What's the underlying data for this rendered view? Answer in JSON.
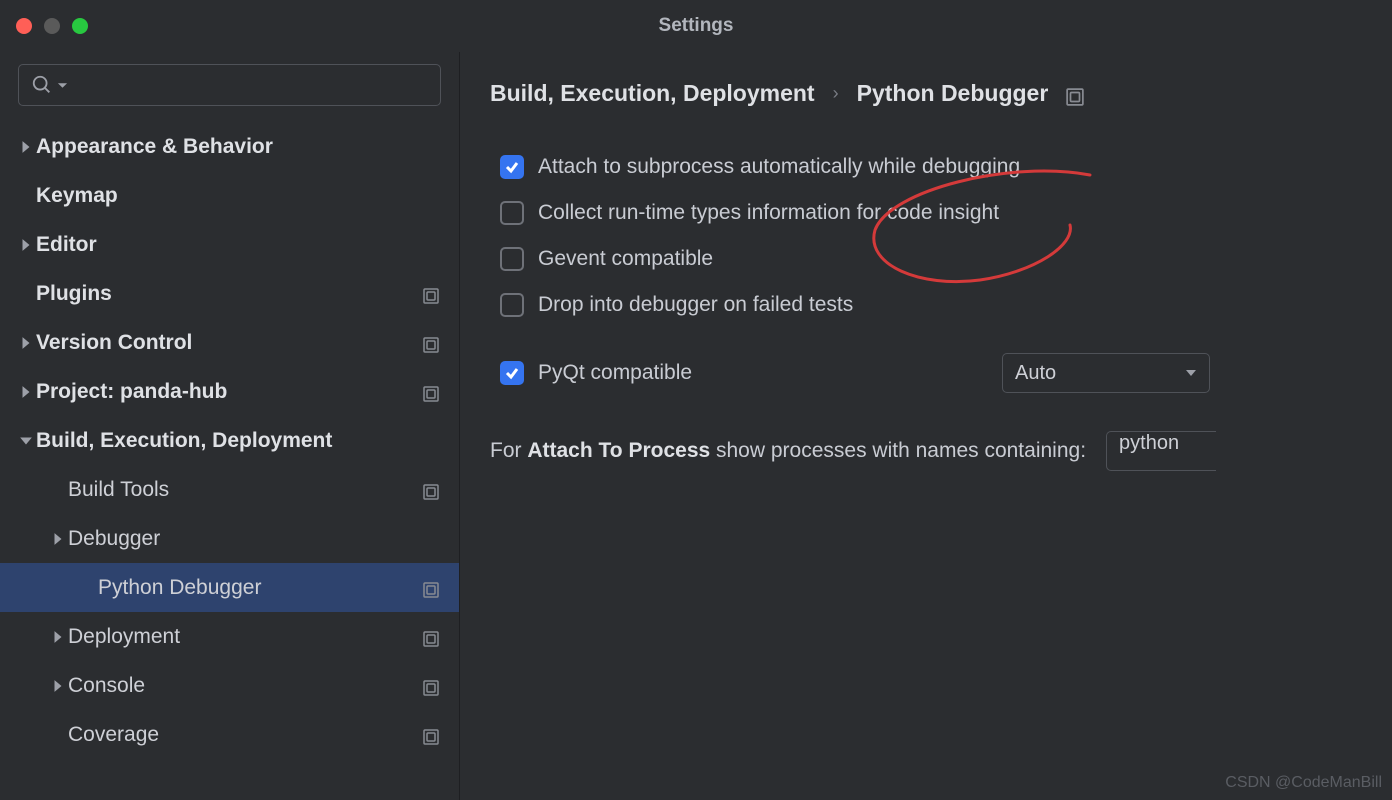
{
  "window": {
    "title": "Settings"
  },
  "sidebar": {
    "search_placeholder": "",
    "items": [
      {
        "label": "Appearance & Behavior",
        "bold": true,
        "expandable": true
      },
      {
        "label": "Keymap",
        "bold": true
      },
      {
        "label": "Editor",
        "bold": true,
        "expandable": true
      },
      {
        "label": "Plugins",
        "bold": true,
        "config": true
      },
      {
        "label": "Version Control",
        "bold": true,
        "expandable": true,
        "config": true
      },
      {
        "label": "Project: panda-hub",
        "bold": true,
        "expandable": true,
        "config": true
      },
      {
        "label": "Build, Execution, Deployment",
        "bold": true,
        "expanded": true
      },
      {
        "label": "Build Tools",
        "indent": 1,
        "config": true
      },
      {
        "label": "Debugger",
        "indent": 1,
        "expandable": true
      },
      {
        "label": "Python Debugger",
        "indent": 2,
        "config": true,
        "selected": true
      },
      {
        "label": "Deployment",
        "indent": 1,
        "expandable": true,
        "config": true
      },
      {
        "label": "Console",
        "indent": 1,
        "expandable": true,
        "config": true
      },
      {
        "label": "Coverage",
        "indent": 1,
        "config": true
      }
    ]
  },
  "breadcrumb": {
    "parent": "Build, Execution, Deployment",
    "current": "Python Debugger"
  },
  "options": {
    "attach_subprocess": {
      "label": "Attach to subprocess automatically while debugging",
      "checked": true
    },
    "collect_runtime": {
      "label": "Collect run-time types information for code insight",
      "checked": false
    },
    "gevent": {
      "label": "Gevent compatible",
      "checked": false
    },
    "drop_debugger": {
      "label": "Drop into debugger on failed tests",
      "checked": false
    },
    "pyqt": {
      "label": "PyQt compatible",
      "checked": true,
      "select_value": "Auto"
    }
  },
  "attach_process": {
    "prefix": "For ",
    "strong": "Attach To Process",
    "suffix": " show processes with names containing:",
    "value": "python"
  },
  "watermark": "CSDN @CodeManBill"
}
